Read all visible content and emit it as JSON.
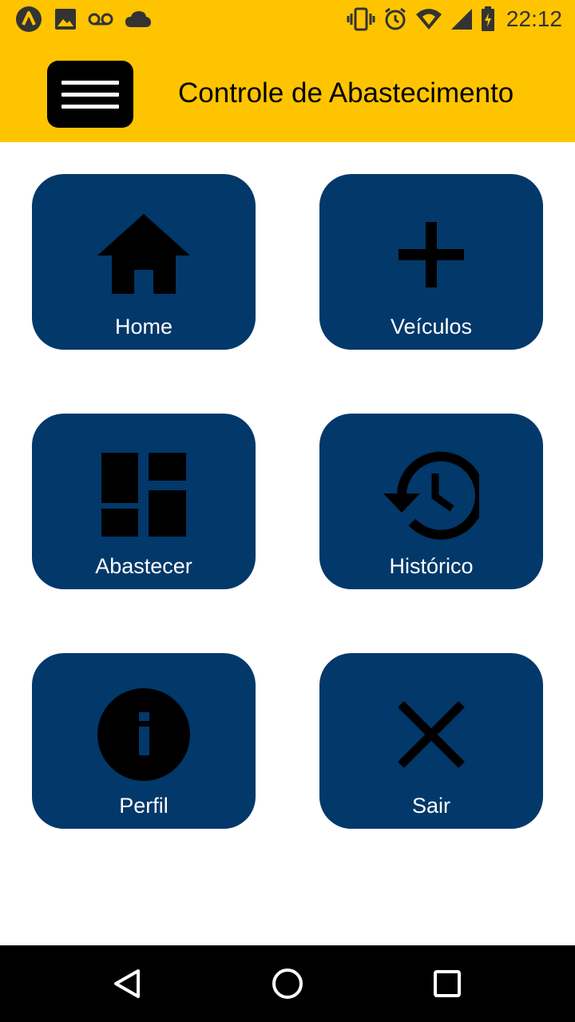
{
  "status_bar": {
    "time": "22:12",
    "left_icons": [
      "app-logo-icon",
      "image-icon",
      "voicemail-icon",
      "cloud-icon"
    ],
    "right_icons": [
      "vibrate-icon",
      "alarm-icon",
      "wifi-icon",
      "signal-icon",
      "battery-icon"
    ]
  },
  "app_bar": {
    "title": "Controle de Abastecimento",
    "background_color": "#FFC400"
  },
  "menu": {
    "tile_color": "#02386A",
    "items": [
      {
        "label": "Home",
        "icon": "home-icon"
      },
      {
        "label": "Veículos",
        "icon": "plus-icon"
      },
      {
        "label": "Abastecer",
        "icon": "dashboard-icon"
      },
      {
        "label": "Histórico",
        "icon": "history-icon"
      },
      {
        "label": "Perfil",
        "icon": "info-icon"
      },
      {
        "label": "Sair",
        "icon": "close-icon"
      }
    ]
  },
  "nav_bar": {
    "buttons": [
      "back-triangle-icon",
      "home-circle-icon",
      "recents-square-icon"
    ]
  }
}
